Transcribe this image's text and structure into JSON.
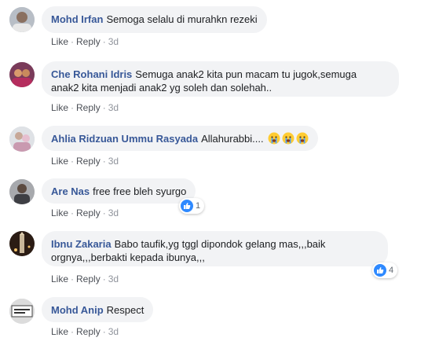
{
  "actions": {
    "like": "Like",
    "reply": "Reply",
    "separator": "·"
  },
  "comments": [
    {
      "author": "Mohd Irfan",
      "text": "Semoga selalu di murahkn rezeki",
      "time": "3d"
    },
    {
      "author": "Che Rohani Idris",
      "text_line1": "Semuga anak2 kita pun macam tu jugok,semuga",
      "text_line2": "anak2 kita menjadi anak2 yg soleh dan solehah..",
      "time": "3d"
    },
    {
      "author": "Ahlia Ridzuan Ummu Rasyada",
      "text": "Allahurabbi....",
      "emoji": "crying-face",
      "time": "3d"
    },
    {
      "author": "Are Nas",
      "text": "free free bleh syurgo",
      "time": "3d",
      "reactions": "1"
    },
    {
      "author": "Ibnu Zakaria",
      "text_line1": "Babo taufik,yg tggl dipondok gelang mas,,,baik",
      "text_line2": "orgnya,,,berbakti kepada ibunya,,,",
      "time": "3d",
      "reactions": "4"
    },
    {
      "author": "Mohd Anip",
      "text": "Respect",
      "time": "3d"
    }
  ],
  "colors": {
    "author": "#385898",
    "bubble": "#f2f3f5",
    "like": "#2e89ff"
  }
}
